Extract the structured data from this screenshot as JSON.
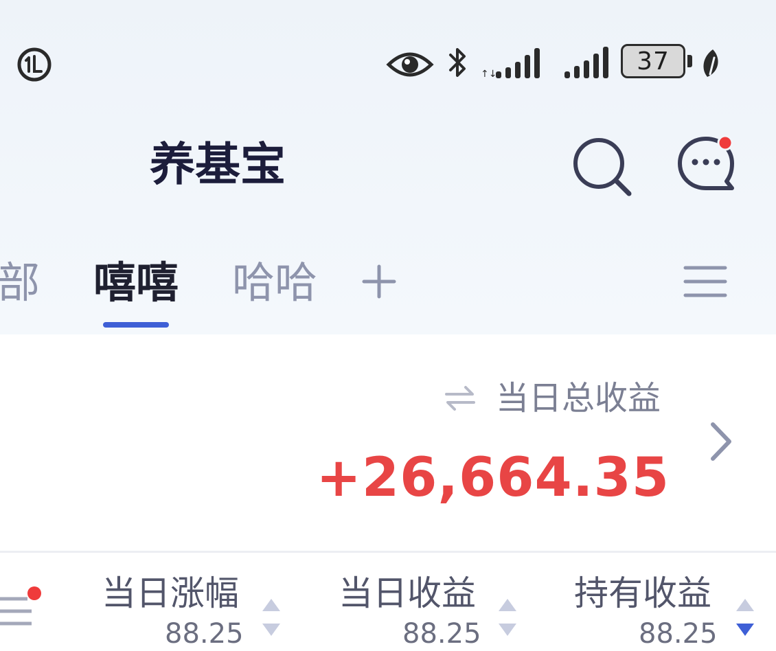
{
  "status_bar": {
    "battery_level": "37",
    "icons": [
      "data-saver-icon",
      "eye-icon",
      "bluetooth-icon",
      "signal-icon",
      "signal-icon",
      "battery-icon",
      "leaf-icon"
    ]
  },
  "header": {
    "title": "养基宝",
    "icons": [
      "search-icon",
      "message-icon"
    ]
  },
  "tabs": [
    {
      "label": "部",
      "active": false
    },
    {
      "label": "嘻嘻",
      "active": true
    },
    {
      "label": "哈哈",
      "active": false
    }
  ],
  "tab_bar_icons": [
    "add-icon",
    "menu-icon"
  ],
  "summary": {
    "label": "当日总收益",
    "value": "+26,664.35",
    "value_color": "#e84545"
  },
  "columns": [
    {
      "label": "当日涨幅",
      "sub": "88.25"
    },
    {
      "label": "当日收益",
      "sub": "88.25"
    },
    {
      "label": "持有收益",
      "sub": "88.25"
    }
  ],
  "colors": {
    "accent": "#3e5fd6",
    "title": "#1c1d3b",
    "muted": "#8e94ac",
    "notification_dot": "#ef3b3b"
  }
}
